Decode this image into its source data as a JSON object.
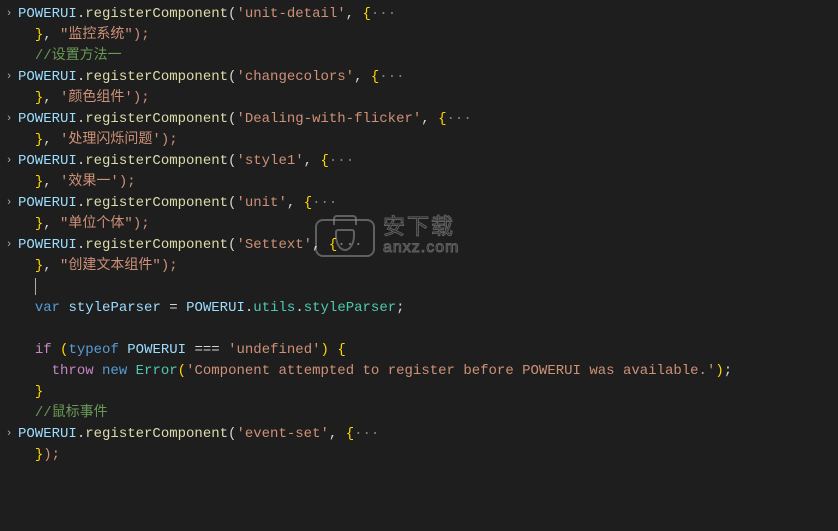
{
  "watermark": {
    "line1": "安下载",
    "line2": "anxz.com"
  },
  "tokens": {
    "obj": "POWERUI",
    "method": "registerComponent",
    "prop_utils": "utils",
    "prop_styleParser": "styleParser",
    "var_styleParser": "styleParser",
    "kw_var": "var",
    "kw_if": "if",
    "kw_typeof": "typeof",
    "kw_throw": "throw",
    "kw_new": "new",
    "type_error": "Error",
    "eq": " = ",
    "tripleeq": " === ",
    "dot": ".",
    "open": "(",
    "close": ")",
    "comma": ", ",
    "semi": ";",
    "lb": "{",
    "rb": "}",
    "ellipsis": "···",
    "indent2": "  ",
    "indent4": "    "
  },
  "calls": [
    {
      "arg": "'unit-detail'",
      "tail": "\"监控系统\");"
    },
    {
      "arg": "'changecolors'",
      "tail": "'颜色组件');"
    },
    {
      "arg": "'Dealing-with-flicker'",
      "tail": "'处理闪烁问题');"
    },
    {
      "arg": "'style1'",
      "tail": "'效果一');"
    },
    {
      "arg": "'unit'",
      "tail": "\"单位个体\");"
    },
    {
      "arg": "'Settext'",
      "tail": "\"创建文本组件\");"
    },
    {
      "arg": "'event-set'",
      "tail": ");"
    }
  ],
  "comments": {
    "c1": "//设置方法一",
    "c2": "//鼠标事件"
  },
  "strings": {
    "undef": "'undefined'",
    "errmsg": "'Component attempted to register before POWERUI was available.'"
  }
}
